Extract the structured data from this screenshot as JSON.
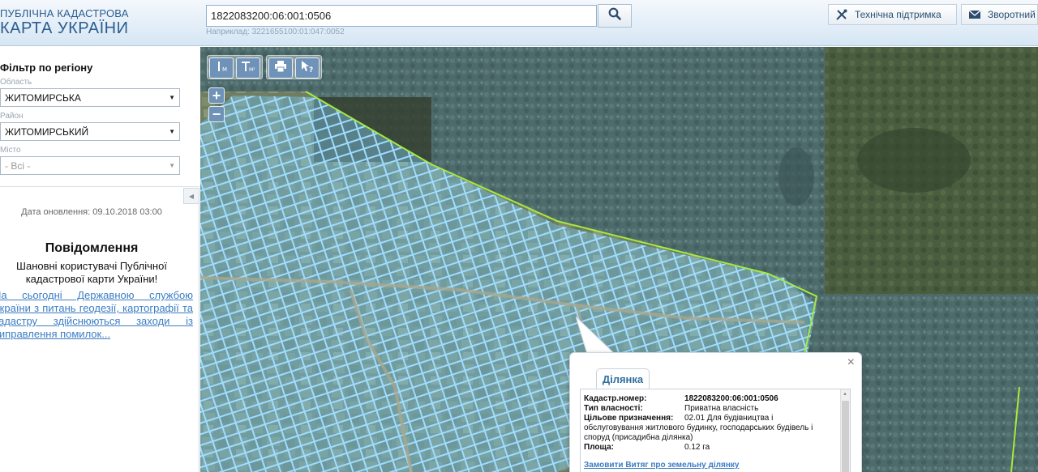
{
  "header": {
    "logo_line1": "ПУБЛІЧНА КАДАСТРОВА",
    "logo_line2": "КАРТА УКРАЇНИ",
    "search_value": "1822083200:06:001:0506",
    "search_hint": "Наприклад: 3221655100:01:047:0052",
    "support_label": "Технічна підтримка",
    "feedback_label": "Зворотний",
    "icons": {
      "search": "search-icon",
      "support": "tools-icon",
      "feedback": "envelope-icon"
    }
  },
  "sidebar": {
    "filter_title": "Фільтр по регіону",
    "oblast_label": "Область",
    "oblast_value": "ЖИТОМИРСЬКА",
    "rayon_label": "Район",
    "rayon_value": "ЖИТОМИРСЬКИЙ",
    "misto_label": "Місто",
    "misto_value": "- Всі -",
    "update_date": "Дата оновлення: 09.10.2018 03:00",
    "message_title": "Повідомлення",
    "message_body": "Шановні користувачі Публічної кадастрової карти України!",
    "message_link": "На сьогодні Державною службою України з питань геодезії, картографії та кадастру здійснюються заходи із виправлення помилок..."
  },
  "map": {
    "tools": [
      "measure-distance",
      "measure-area",
      "print",
      "identify"
    ],
    "zoom_in": "+",
    "zoom_out": "−"
  },
  "popup": {
    "tab_label": "Ділянка",
    "close": "×",
    "rows": [
      {
        "key": "Кадастр.номер:",
        "value": "1822083200:06:001:0506"
      },
      {
        "key": "Тип власності:",
        "value": "Приватна власність"
      },
      {
        "key": "Цільове призначення:",
        "value": "02.01 Для будівництва і"
      },
      {
        "key": "",
        "value": "обслуговування житлового будинку, господарських будівель і"
      },
      {
        "key": "",
        "value": "споруд (присадибна ділянка)"
      },
      {
        "key": "Площа:",
        "value": "0.12 га"
      }
    ],
    "link": "Замовити Витяг про земельну ділянку"
  },
  "colors": {
    "brand": "#2a5d8f",
    "link": "#3b7dc4",
    "parcel": "#8fd0f5",
    "boundary": "#9be33a"
  }
}
